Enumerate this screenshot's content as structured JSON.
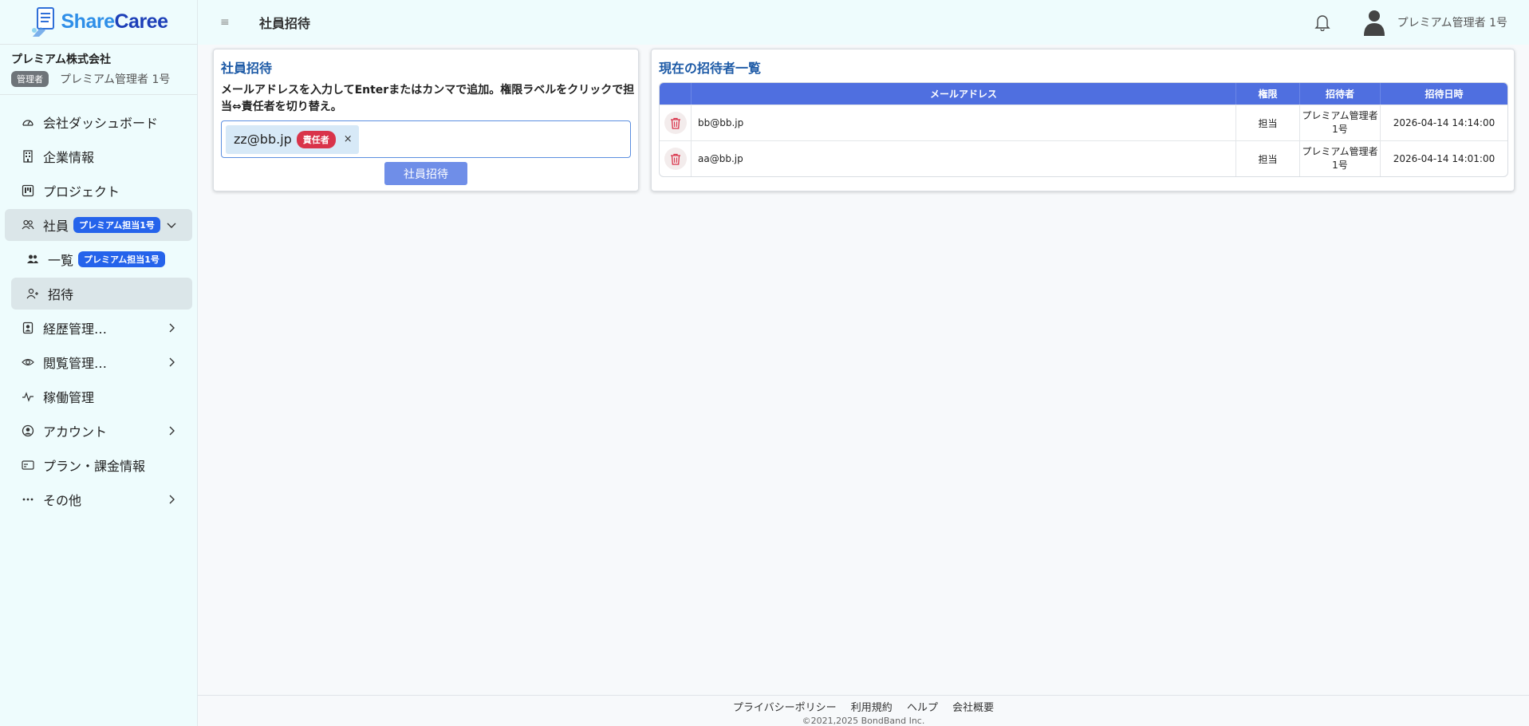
{
  "brand": {
    "part1": "Share",
    "part2": "Caree"
  },
  "company": {
    "name": "プレミアム株式会社",
    "role_badge": "管理者",
    "user": "プレミアム管理者 1号"
  },
  "nav": {
    "dashboard": "会社ダッシュボード",
    "company_info": "企業情報",
    "project": "プロジェクト",
    "employees": "社員",
    "employees_badge": "プレミアム担当1号",
    "list": "一覧",
    "list_badge": "プレミアム担当1号",
    "invite": "招待",
    "career": "経歴管理…",
    "browse": "閲覧管理…",
    "operation": "稼働管理",
    "account": "アカウント",
    "plan": "プラン・課金情報",
    "other": "その他"
  },
  "header": {
    "menu_glyph": "≡",
    "title": "社員招待",
    "user": "プレミアム管理者 1号"
  },
  "invite_form": {
    "title": "社員招待",
    "instructions": "メールアドレスを入力してEnterまたはカンマで追加。権限ラベルをクリックで担当⇔責任者を切り替え。",
    "tag": {
      "email": "zz@bb.jp",
      "role": "責任者",
      "remove": "×"
    },
    "button": "社員招待"
  },
  "invitees": {
    "title": "現在の招待者一覧",
    "columns": {
      "email": "メールアドレス",
      "role": "権限",
      "inviter": "招待者",
      "date": "招待日時"
    },
    "rows": [
      {
        "email": "bb@bb.jp",
        "role": "担当",
        "inviter": "プレミアム管理者 1号",
        "date": "2026-04-14 14:14:00"
      },
      {
        "email": "aa@bb.jp",
        "role": "担当",
        "inviter": "プレミアム管理者 1号",
        "date": "2026-04-14 14:01:00"
      }
    ]
  },
  "footer": {
    "links": [
      "プライバシーポリシー",
      "利用規約",
      "ヘルプ",
      "会社概要"
    ],
    "copyright": "©2021,2025 BondBand Inc."
  },
  "colors": {
    "accent": "#4f6fe0",
    "badge_blue": "#2563eb",
    "danger": "#d9334a",
    "sidebar_bg": "#eefcfd"
  }
}
